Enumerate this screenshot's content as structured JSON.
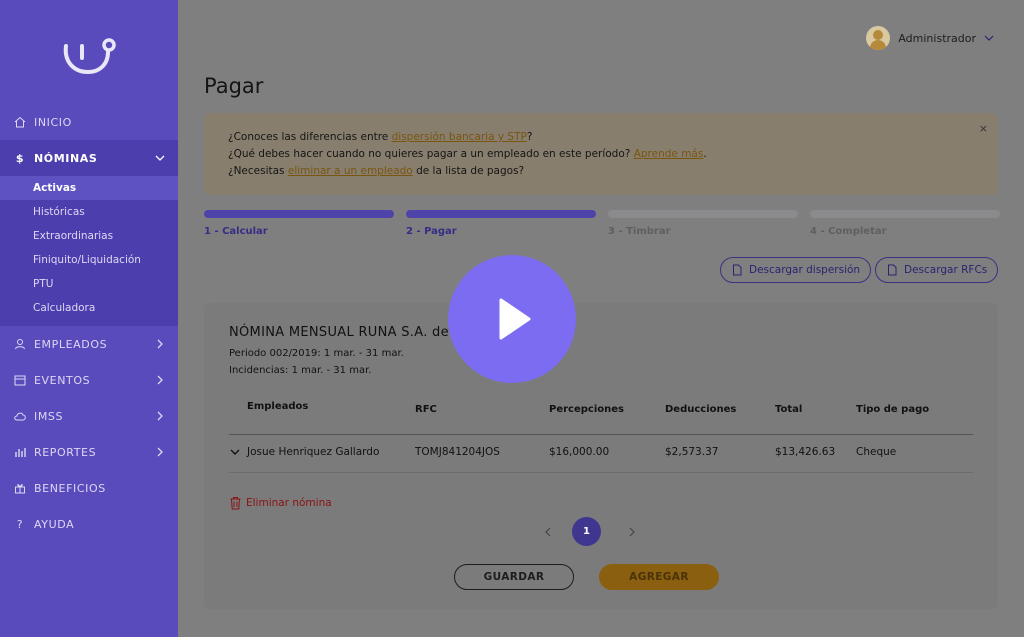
{
  "sidebar": {
    "items": [
      {
        "label": "INICIO",
        "icon": "home-icon"
      },
      {
        "label": "NÓMINAS",
        "icon": "dollar-icon",
        "open": true
      },
      {
        "label": "EMPLEADOS",
        "icon": "user-icon"
      },
      {
        "label": "EVENTOS",
        "icon": "calendar-icon"
      },
      {
        "label": "IMSS",
        "icon": "cloud-icon"
      },
      {
        "label": "REPORTES",
        "icon": "bar-chart-icon"
      },
      {
        "label": "BENEFICIOS",
        "icon": "gift-icon"
      },
      {
        "label": "AYUDA",
        "icon": "question-icon"
      }
    ],
    "subitems": [
      "Activas",
      "Históricas",
      "Extraordinarias",
      "Finiquito/Liquidación",
      "PTU",
      "Calculadora"
    ],
    "active_subitem": "Activas"
  },
  "header": {
    "user_name": "Administrador"
  },
  "page": {
    "title": "Pagar"
  },
  "notice": {
    "line1_pre": "¿Conoces las diferencias entre ",
    "line1_link": "dispersión bancaria y STP",
    "line1_post": "?",
    "line2_pre": "¿Qué debes hacer cuando no quieres pagar a un empleado en este período? ",
    "line2_link": "Aprende más",
    "line2_post": ".",
    "line3_pre": "¿Necesitas ",
    "line3_link": "eliminar a un empleado",
    "line3_post": " de la lista de pagos?",
    "close": "×"
  },
  "steps": [
    {
      "label": "1 - Calcular",
      "done": true
    },
    {
      "label": "2 - Pagar",
      "done": true
    },
    {
      "label": "3 - Timbrar",
      "done": false
    },
    {
      "label": "4 - Completar",
      "done": false
    }
  ],
  "actions": {
    "download_dispersion": "Descargar dispersión",
    "download_rfcs": "Descargar RFCs"
  },
  "payroll": {
    "title": "NÓMINA MENSUAL RUNA S.A. de C",
    "period": "Periodo 002/2019: 1 mar. - 31 mar.",
    "incidences": "Incidencias: 1 mar. - 31 mar.",
    "columns": [
      "Empleados",
      "RFC",
      "Percepciones",
      "Deducciones",
      "Total",
      "Tipo de pago"
    ],
    "rows": [
      {
        "employee": "Josue Henriquez Gallardo",
        "rfc": "TOMJ841204JOS",
        "perceptions": "$16,000.00",
        "deductions": "$2,573.37",
        "total": "$13,426.63",
        "payment_type": "Cheque"
      }
    ],
    "delete_label": "Eliminar nómina",
    "current_page": "1",
    "save_label": "GUARDAR",
    "add_label": "AGREGAR"
  },
  "colors": {
    "sidebar": "#5a4bbd",
    "accent": "#4e43a9",
    "play": "#7b6cf1",
    "warning": "#e0a22a"
  }
}
